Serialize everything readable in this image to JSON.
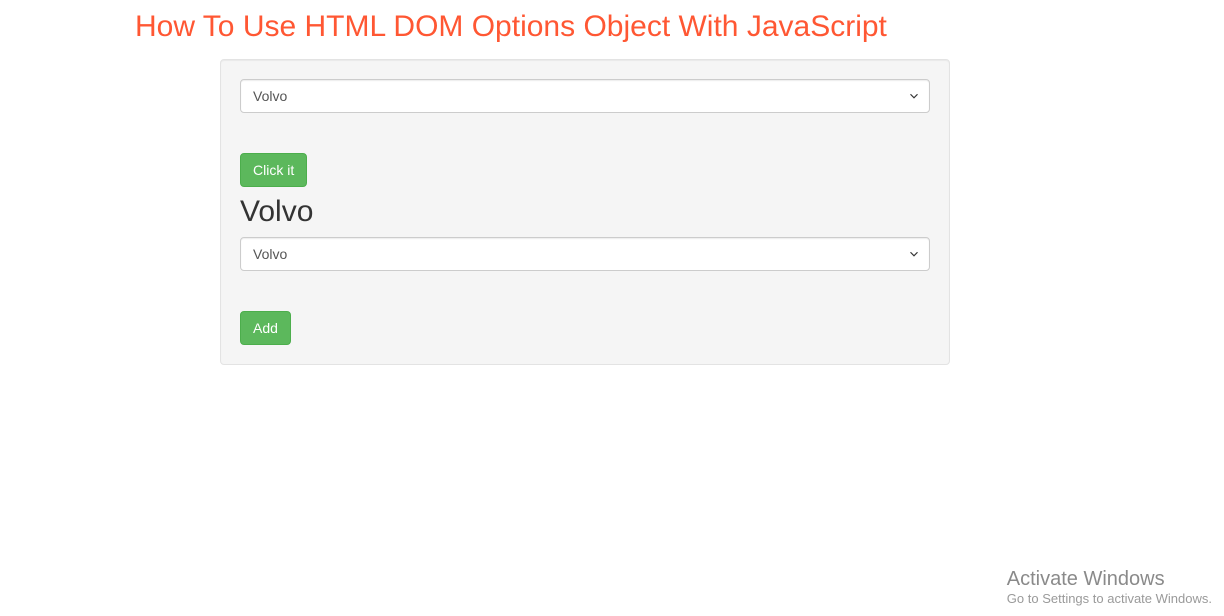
{
  "title": "How To Use HTML DOM Options Object With JavaScript",
  "select1": {
    "selected": "Volvo"
  },
  "button1": {
    "label": "Click it"
  },
  "result": "Volvo",
  "select2": {
    "selected": "Volvo"
  },
  "button2": {
    "label": "Add"
  },
  "watermark": {
    "title": "Activate Windows",
    "subtitle": "Go to Settings to activate Windows."
  }
}
